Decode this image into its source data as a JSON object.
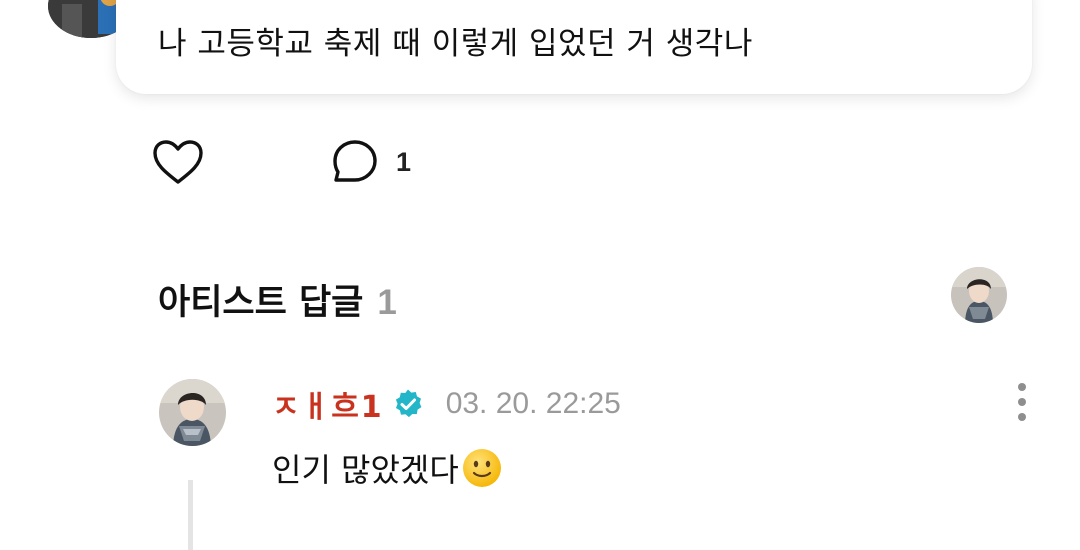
{
  "post": {
    "text": "나 고등학교 축제 때 이렇게 입었던 거 생각나",
    "comment_count": "1"
  },
  "artist_replies": {
    "title": "아티스트 답글",
    "count": "1"
  },
  "reply": {
    "author": "ㅈㅐ흐1",
    "timestamp": "03. 20. 22:25",
    "text": "인기 많았겠다"
  },
  "icons": {
    "like": "heart-outline-icon",
    "comment": "speech-bubble-icon",
    "verified": "verified-badge-icon",
    "more": "more-vertical-icon",
    "emoji": "slightly-smiling-face-emoji"
  },
  "colors": {
    "author": "#c8321e",
    "verified": "#22b6c8",
    "muted": "#9a9a9a",
    "thread_line": "#e4e4e4"
  }
}
